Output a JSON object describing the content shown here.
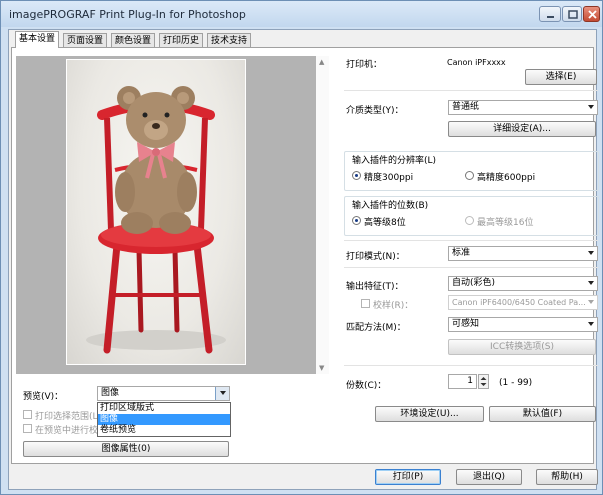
{
  "window": {
    "title": "imagePROGRAF Print Plug-In for Photoshop",
    "controls": [
      "minimize-icon",
      "maximize-icon",
      "close-icon"
    ]
  },
  "tabs": [
    {
      "label": "基本设置",
      "active": true
    },
    {
      "label": "页面设置",
      "active": false
    },
    {
      "label": "颜色设置",
      "active": false
    },
    {
      "label": "打印历史",
      "active": false
    },
    {
      "label": "技术支持",
      "active": false
    }
  ],
  "preview": {
    "label": "预览(V)：",
    "select_value": "图像",
    "dropdown_options": [
      "打印区域版式",
      "图像",
      "卷纸预览"
    ],
    "highlighted_option": "图像",
    "print_selection_label": "打印选择范围(L)",
    "preview_check_label": "在预览中进行校",
    "image_properties_button": "图像属性(0)"
  },
  "printer": {
    "label": "打印机：",
    "name": "Canon iPFxxxx",
    "select_button": "选择(E)"
  },
  "media": {
    "label": "介质类型(Y)：",
    "value": "普通纸",
    "detail_button": "详细设定(A)..."
  },
  "resolution": {
    "label": "输入插件的分辨率(L)",
    "options": [
      {
        "label": "精度300ppi",
        "selected": true,
        "enabled": true
      },
      {
        "label": "高精度600ppi",
        "selected": false,
        "enabled": true
      }
    ]
  },
  "bits": {
    "label": "输入插件的位数(B)",
    "options": [
      {
        "label": "高等级8位",
        "selected": true,
        "enabled": true
      },
      {
        "label": "最高等级16位",
        "selected": false,
        "enabled": false
      }
    ]
  },
  "print_mode": {
    "label": "打印模式(N)：",
    "value": "标准"
  },
  "output_profile": {
    "label": "输出特征(T)：",
    "value": "自动(彩色)"
  },
  "proof": {
    "label": "校样(R)：",
    "value": "Canon iPF6400/6450 Coated Pa..."
  },
  "matching": {
    "label": "匹配方法(M)：",
    "value": "可感知",
    "icc_button": "ICC转换选项(S)"
  },
  "copies": {
    "label": "份数(C)：",
    "value": "1",
    "range": "(1 - 99)"
  },
  "settings_buttons": {
    "environment": "环境设定(U)...",
    "defaults": "默认值(F)"
  },
  "footer": {
    "print": "打印(P)",
    "exit": "退出(Q)",
    "help": "帮助(H)"
  },
  "colors": {
    "accent": "#3399ff",
    "title_bar": "#cfe0f2",
    "chair": "#d8262f"
  }
}
